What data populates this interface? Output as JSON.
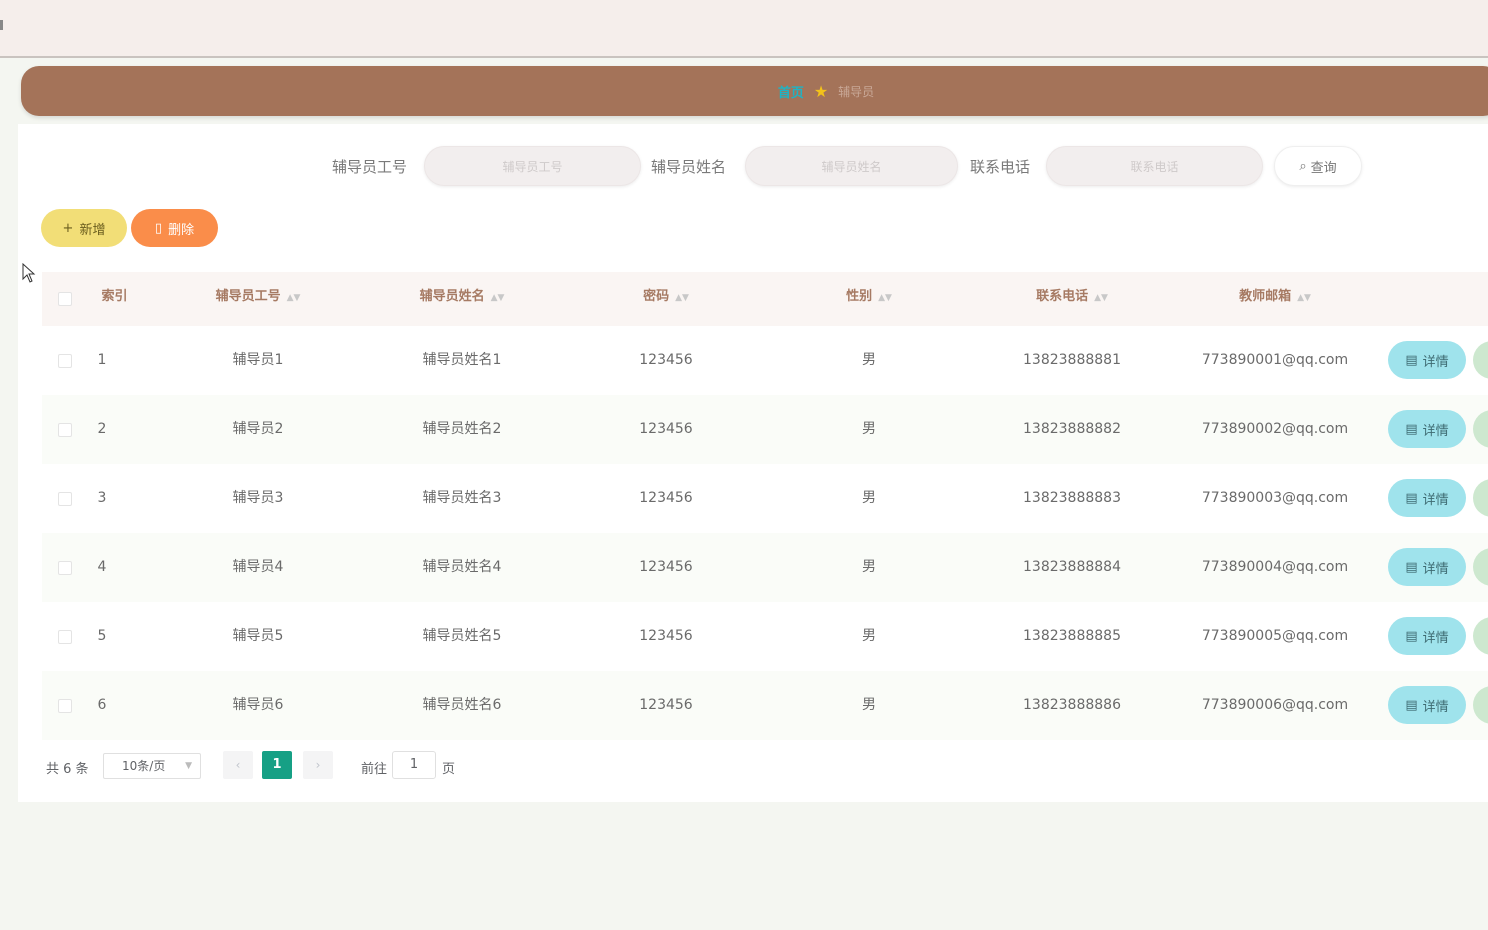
{
  "breadcrumb": {
    "home": "首页",
    "current": "辅导员"
  },
  "search": {
    "fields": [
      {
        "label": "辅导员工号",
        "placeholder": "辅导员工号"
      },
      {
        "label": "辅导员姓名",
        "placeholder": "辅导员姓名"
      },
      {
        "label": "联系电话",
        "placeholder": "联系电话"
      }
    ],
    "button": "查询"
  },
  "actions": {
    "add": "新增",
    "delete": "删除"
  },
  "table": {
    "columns": [
      "索引",
      "辅导员工号",
      "辅导员姓名",
      "密码",
      "性别",
      "联系电话",
      "教师邮箱"
    ],
    "rows": [
      {
        "index": "1",
        "id": "辅导员1",
        "name": "辅导员姓名1",
        "password": "123456",
        "gender": "男",
        "phone": "13823888881",
        "email": "773890001@qq.com"
      },
      {
        "index": "2",
        "id": "辅导员2",
        "name": "辅导员姓名2",
        "password": "123456",
        "gender": "男",
        "phone": "13823888882",
        "email": "773890002@qq.com"
      },
      {
        "index": "3",
        "id": "辅导员3",
        "name": "辅导员姓名3",
        "password": "123456",
        "gender": "男",
        "phone": "13823888883",
        "email": "773890003@qq.com"
      },
      {
        "index": "4",
        "id": "辅导员4",
        "name": "辅导员姓名4",
        "password": "123456",
        "gender": "男",
        "phone": "13823888884",
        "email": "773890004@qq.com"
      },
      {
        "index": "5",
        "id": "辅导员5",
        "name": "辅导员姓名5",
        "password": "123456",
        "gender": "男",
        "phone": "13823888885",
        "email": "773890005@qq.com"
      },
      {
        "index": "6",
        "id": "辅导员6",
        "name": "辅导员姓名6",
        "password": "123456",
        "gender": "男",
        "phone": "13823888886",
        "email": "773890006@qq.com"
      }
    ],
    "detail_label": "详情"
  },
  "pagination": {
    "total": "共 6 条",
    "page_size": "10条/页",
    "current_page": "1",
    "goto_label": "前往",
    "goto_value": "1",
    "page_unit": "页"
  },
  "colors": {
    "breadcrumb_bg": "#a47359",
    "add_button": "#f2de77",
    "delete_button": "#fa8d4a",
    "detail_button": "#9fe3ec",
    "current_page": "#16a085"
  }
}
